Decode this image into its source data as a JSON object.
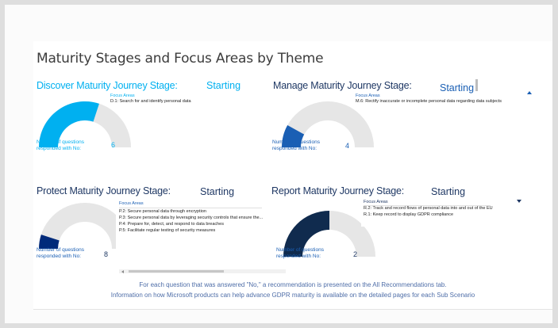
{
  "title": "Maturity Stages and Focus Areas by Theme",
  "colors": {
    "discover": "#00b0f0",
    "manage": "#1a5fb4",
    "protect": "#002a7a",
    "report": "#102b4e",
    "track": "#e6e6e6",
    "heading_dark": "#1f3864"
  },
  "themes": {
    "discover": {
      "heading": "Discover Maturity Journey Stage:",
      "stage": "Starting",
      "focus_label": "Focus Areas",
      "focus_items": [
        "D.1: Search for and identify personal data"
      ],
      "questions_label": "Number of questions responded with No:",
      "questions_count": "6",
      "gauge_fraction": 0.6
    },
    "manage": {
      "heading": "Manage Maturity Journey Stage:",
      "stage": "Starting",
      "focus_label": "Focus Areas",
      "focus_items": [
        "M.6: Rectify inaccurate or incomplete personal data regarding data subjects"
      ],
      "questions_label": "Number of questions responded with No:",
      "questions_count": "4",
      "gauge_fraction": 0.16
    },
    "protect": {
      "heading": "Protect Maturity Journey Stage:",
      "stage": "Starting",
      "focus_label": "Focus Areas",
      "focus_items": [
        "P.2: Secure personal data through encryption",
        "P.3: Secure personal data by leveraging security controls that ensure the...",
        "P.4: Prepare for, detect, and respond to data breaches",
        "P.5: Facilitate regular testing of security measures"
      ],
      "questions_label": "Number of questions responded with No:",
      "questions_count": "8",
      "gauge_fraction": 0.1
    },
    "report": {
      "heading": "Report Maturity Journey Stage:",
      "stage": "Starting",
      "focus_label": "Focus Areas",
      "focus_items": [
        "R.2: Track and record flows of personal data into and out of the EU",
        "R.1: Keep record to display GDPR compliance"
      ],
      "questions_label": "Number of questions responded with No:",
      "questions_count": "2",
      "gauge_fraction": 0.5
    }
  },
  "footer": {
    "line1": "For each question that was answered \"No,\" a recommendation is presented on the All Recommendations tab.",
    "line2": "Information on how Microsoft products can help advance GDPR maturity is available on the detailed pages for each Sub Scenario"
  }
}
